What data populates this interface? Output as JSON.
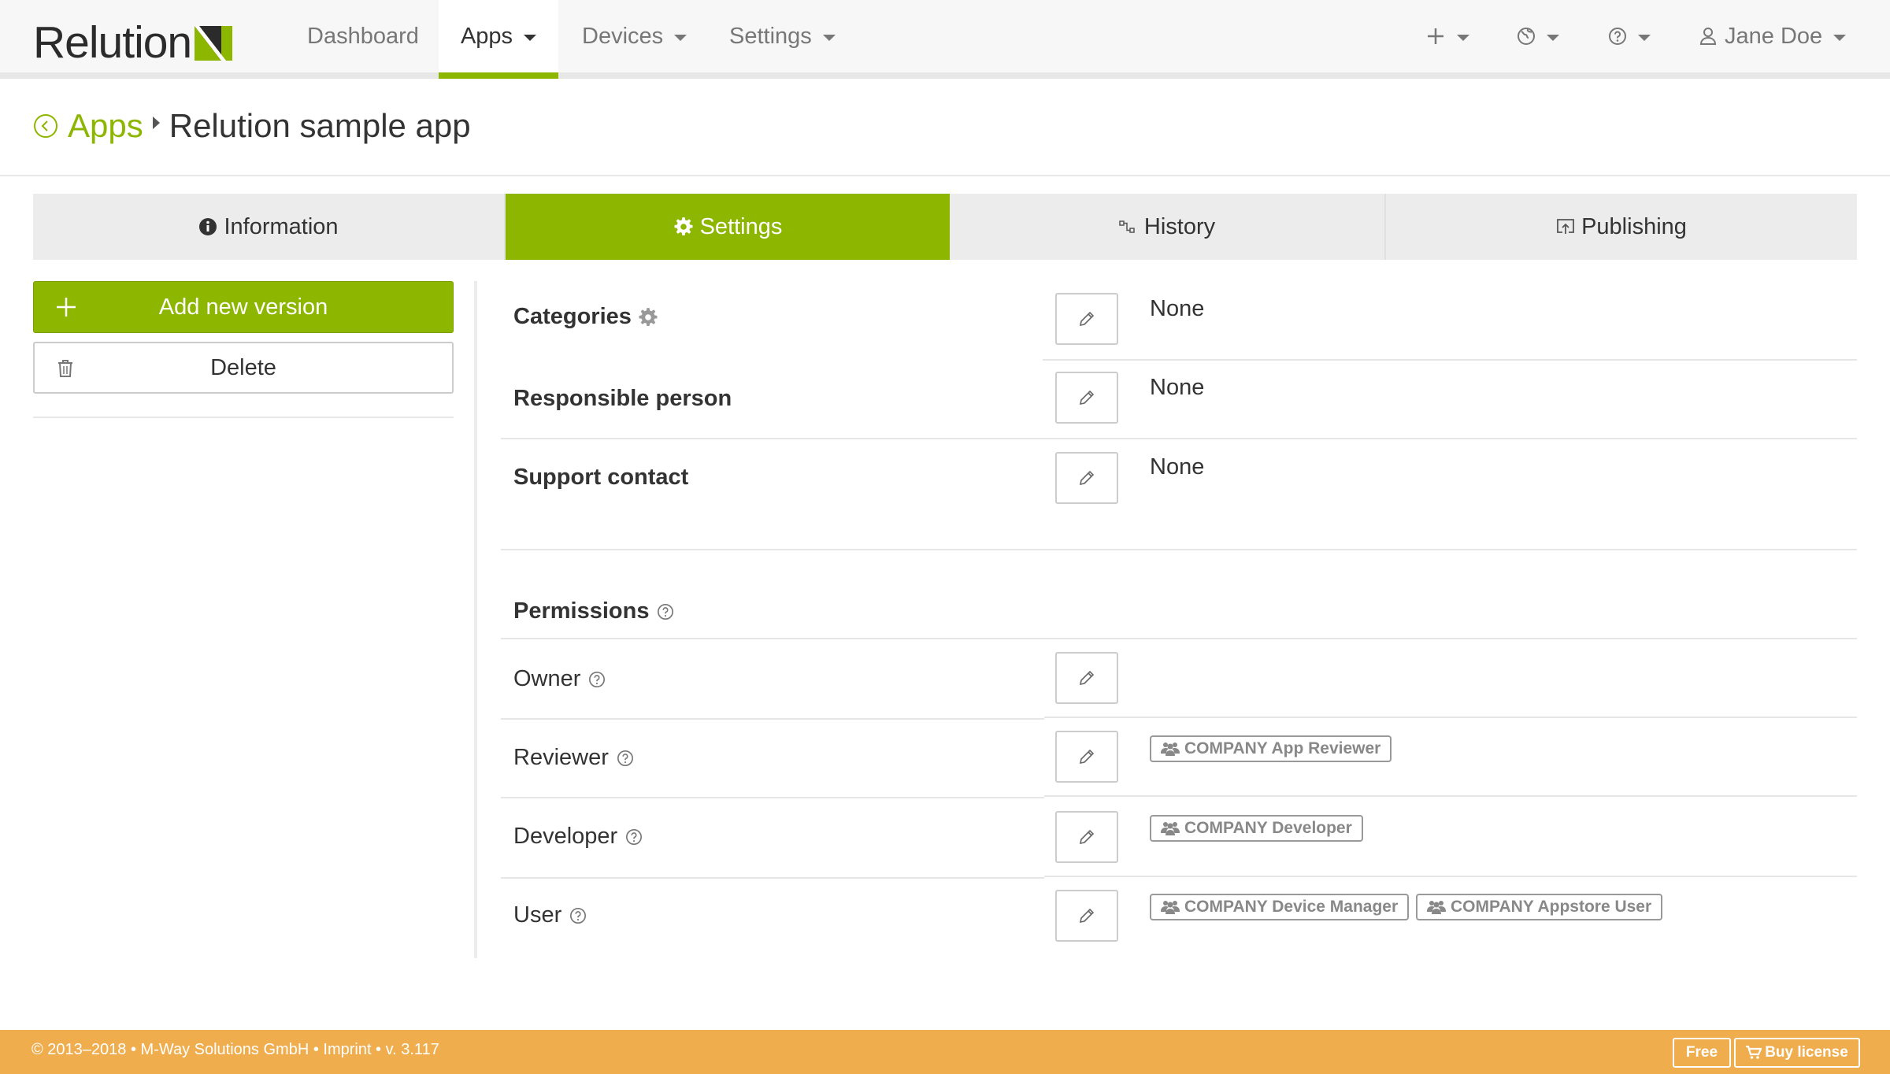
{
  "app": {
    "logo_text": "Relution",
    "brand_color": "#8db600",
    "footer_color": "#f0ad4e"
  },
  "nav": {
    "items": [
      {
        "label": "Dashboard"
      },
      {
        "label": "Apps"
      },
      {
        "label": "Devices"
      },
      {
        "label": "Settings"
      }
    ],
    "active": "Apps",
    "icons": [
      "plus-icon",
      "globe-icon",
      "help-icon",
      "user-icon"
    ],
    "user_name": "Jane Doe"
  },
  "breadcrumb": {
    "parent": "Apps",
    "title": "Relution sample app"
  },
  "tabs": [
    {
      "label": "Information",
      "icon": "info-icon"
    },
    {
      "label": "Settings",
      "icon": "gear-icon"
    },
    {
      "label": "History",
      "icon": "history-icon"
    },
    {
      "label": "Publishing",
      "icon": "publish-icon"
    }
  ],
  "active_tab": "Settings",
  "sidebar": {
    "add_label": "Add new version",
    "delete_label": "Delete"
  },
  "settings": {
    "rows": [
      {
        "label": "Categories",
        "value": "None"
      },
      {
        "label": "Responsible person",
        "value": "None"
      },
      {
        "label": "Support contact",
        "value": "None"
      }
    ]
  },
  "permissions": {
    "title": "Permissions",
    "rows": [
      {
        "label": "Owner",
        "tags": []
      },
      {
        "label": "Reviewer",
        "tags": [
          "COMPANY App Reviewer"
        ]
      },
      {
        "label": "Developer",
        "tags": [
          "COMPANY Developer"
        ]
      },
      {
        "label": "User",
        "tags": [
          "COMPANY Device Manager",
          "COMPANY Appstore User"
        ]
      }
    ]
  },
  "footer": {
    "text": "© 2013–2018 • M-Way Solutions GmbH • Imprint • v. 3.117",
    "free_label": "Free",
    "buy_label": "Buy license"
  }
}
